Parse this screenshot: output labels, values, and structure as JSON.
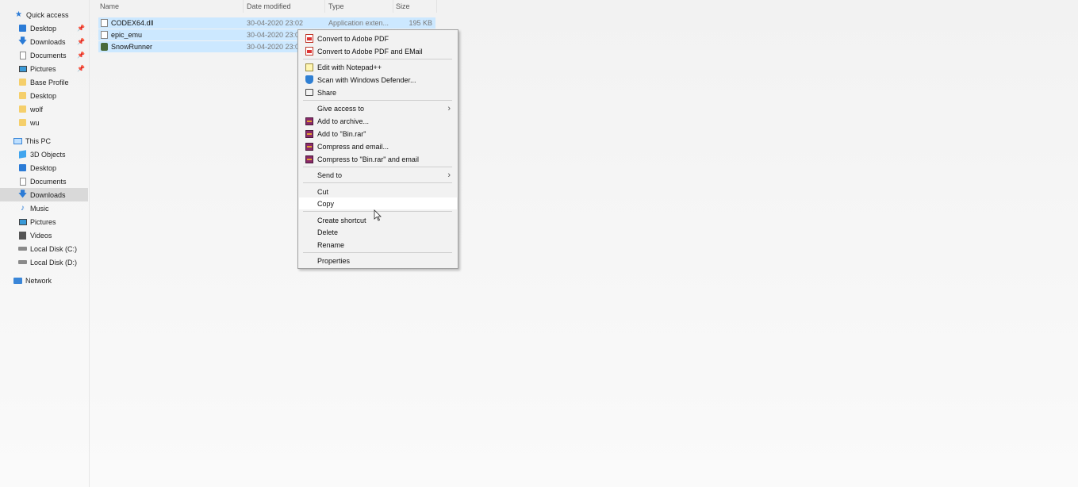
{
  "nav": {
    "items": [
      {
        "label": "Quick access",
        "icon": "star-icon",
        "pinned": false,
        "selected": false
      },
      {
        "label": "Desktop",
        "icon": "desktop-folder-icon",
        "pinned": true,
        "selected": false
      },
      {
        "label": "Downloads",
        "icon": "download-arrow-icon",
        "pinned": true,
        "selected": false
      },
      {
        "label": "Documents",
        "icon": "document-icon",
        "pinned": true,
        "selected": false
      },
      {
        "label": "Pictures",
        "icon": "pictures-icon",
        "pinned": true,
        "selected": false
      },
      {
        "label": "Base Profile",
        "icon": "folder-icon",
        "pinned": false,
        "selected": false
      },
      {
        "label": "Desktop",
        "icon": "folder-icon",
        "pinned": false,
        "selected": false
      },
      {
        "label": "wolf",
        "icon": "folder-icon",
        "pinned": false,
        "selected": false
      },
      {
        "label": "wu",
        "icon": "folder-icon",
        "pinned": false,
        "selected": false
      },
      {
        "label": "This PC",
        "icon": "computer-icon",
        "pinned": false,
        "selected": false
      },
      {
        "label": "3D Objects",
        "icon": "cube-icon",
        "pinned": false,
        "selected": false
      },
      {
        "label": "Desktop",
        "icon": "desktop-folder-icon",
        "pinned": false,
        "selected": false
      },
      {
        "label": "Documents",
        "icon": "document-icon",
        "pinned": false,
        "selected": false
      },
      {
        "label": "Downloads",
        "icon": "download-arrow-icon",
        "pinned": false,
        "selected": true
      },
      {
        "label": "Music",
        "icon": "music-note-icon",
        "pinned": false,
        "selected": false
      },
      {
        "label": "Pictures",
        "icon": "pictures-icon",
        "pinned": false,
        "selected": false
      },
      {
        "label": "Videos",
        "icon": "film-icon",
        "pinned": false,
        "selected": false
      },
      {
        "label": "Local Disk (C:)",
        "icon": "drive-icon",
        "pinned": false,
        "selected": false
      },
      {
        "label": "Local Disk (D:)",
        "icon": "drive-icon",
        "pinned": false,
        "selected": false
      },
      {
        "label": "Network",
        "icon": "network-icon",
        "pinned": false,
        "selected": false
      }
    ],
    "pin_glyph": "📌"
  },
  "columns": {
    "name": "Name",
    "date": "Date modified",
    "type": "Type",
    "size": "Size"
  },
  "files": [
    {
      "name": "CODEX64.dll",
      "date": "30-04-2020 23:02",
      "type": "Application exten...",
      "size": "195 KB",
      "icon": "dll-file-icon"
    },
    {
      "name": "epic_emu",
      "date": "30-04-2020 23:02",
      "type": "",
      "size": "",
      "icon": "config-file-icon"
    },
    {
      "name": "SnowRunner",
      "date": "30-04-2020 23:02",
      "type": "",
      "size": "",
      "icon": "app-exe-icon"
    }
  ],
  "context_menu": {
    "items": [
      {
        "label": "Convert to Adobe PDF",
        "icon": "adobe-pdf-icon",
        "submenu": false
      },
      {
        "label": "Convert to Adobe PDF and EMail",
        "icon": "adobe-pdf-email-icon",
        "submenu": false
      },
      {
        "label": "Edit with Notepad++",
        "icon": "notepad-plus-icon",
        "submenu": false
      },
      {
        "label": "Scan with Windows Defender...",
        "icon": "defender-shield-icon",
        "submenu": false
      },
      {
        "label": "Share",
        "icon": "share-icon",
        "submenu": false
      },
      {
        "label": "Give access to",
        "icon": "",
        "submenu": true
      },
      {
        "label": "Add to archive...",
        "icon": "winrar-icon",
        "submenu": false
      },
      {
        "label": "Add to \"Bin.rar\"",
        "icon": "winrar-icon",
        "submenu": false
      },
      {
        "label": "Compress and email...",
        "icon": "winrar-icon",
        "submenu": false
      },
      {
        "label": "Compress to \"Bin.rar\" and email",
        "icon": "winrar-icon",
        "submenu": false
      },
      {
        "label": "Send to",
        "icon": "",
        "submenu": true
      },
      {
        "label": "Cut",
        "icon": "",
        "submenu": false
      },
      {
        "label": "Copy",
        "icon": "",
        "submenu": false,
        "hovered": true
      },
      {
        "label": "Create shortcut",
        "icon": "",
        "submenu": false
      },
      {
        "label": "Delete",
        "icon": "",
        "submenu": false
      },
      {
        "label": "Rename",
        "icon": "",
        "submenu": false
      },
      {
        "label": "Properties",
        "icon": "",
        "submenu": false
      }
    ],
    "submenu_glyph": "›"
  },
  "colors": {
    "selection": "#cce8ff",
    "nav_selected": "#d9d9d9",
    "menu_bg": "#f2f2f2"
  }
}
